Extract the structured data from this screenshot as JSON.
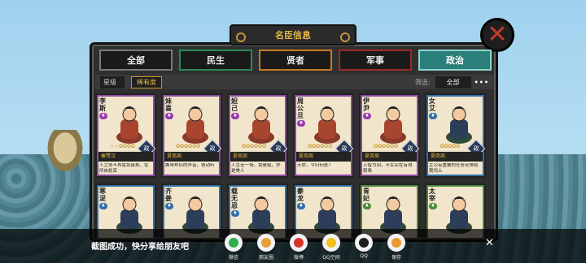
{
  "window": {
    "title": "名臣信息",
    "close_icon": "✕"
  },
  "tabs": [
    {
      "label": "全部",
      "active": false
    },
    {
      "label": "民生",
      "active": false
    },
    {
      "label": "贤者",
      "active": false
    },
    {
      "label": "军事",
      "active": false
    },
    {
      "label": "政治",
      "active": true
    }
  ],
  "filter": {
    "star_label": "星级",
    "rarity_label": "稀有度",
    "filter_label": "筛选:",
    "filter_value": "全部",
    "more": "•••"
  },
  "cards": [
    {
      "name": "李斯",
      "tier": "purple",
      "stars": "☆☆✪✪✪✪",
      "role": "政",
      "dynasty": "秦赞汉",
      "quote": "人之贤不肖譬如鼠矣，在所自处耳"
    },
    {
      "name": "妹喜",
      "tier": "purple",
      "stars": "✪✪✪✪✪✪",
      "role": "政",
      "dynasty": "夏商周",
      "quote": "撕帛布匹的声音，很动听"
    },
    {
      "name": "妲己",
      "tier": "purple",
      "stars": "✪✪✪✪✪✪",
      "role": "政",
      "dynasty": "夏商周",
      "quote": "人生苦一场，我是狐，亦是美人"
    },
    {
      "name": "周公旦",
      "tier": "purple",
      "stars": "✪✪✪✪✪✪",
      "role": "政",
      "dynasty": "夏商周",
      "quote": "天命，今归何处？"
    },
    {
      "name": "伊尹",
      "tier": "purple",
      "stars": "✪✪✪✪✪✪",
      "role": "政",
      "dynasty": "夏商周",
      "quote": "上智为间，不军实在有得箭焉"
    },
    {
      "name": "女艾",
      "tier": "blue",
      "stars": "✪✪✪✪✪",
      "role": "政",
      "dynasty": "夏商周",
      "quote": "主公有重要的任务安排给我吗么"
    },
    {
      "name": "寒浞",
      "tier": "blue",
      "stars": "",
      "role": "",
      "dynasty": "",
      "quote": ""
    },
    {
      "name": "齐姜",
      "tier": "blue",
      "stars": "",
      "role": "",
      "dynasty": "",
      "quote": ""
    },
    {
      "name": "载无忌",
      "tier": "blue",
      "stars": "",
      "role": "",
      "dynasty": "",
      "quote": ""
    },
    {
      "name": "豢龙",
      "tier": "blue",
      "stars": "",
      "role": "",
      "dynasty": "",
      "quote": ""
    },
    {
      "name": "青妃",
      "tier": "green",
      "stars": "",
      "role": "",
      "dynasty": "",
      "quote": ""
    },
    {
      "name": "太宰",
      "tier": "green",
      "stars": "",
      "role": "",
      "dynasty": "",
      "quote": ""
    }
  ],
  "share": {
    "message": "截图成功，快分享给朋友吧",
    "items": [
      {
        "label": "微信",
        "icon": "wechat-icon",
        "color": "#2ab14a"
      },
      {
        "label": "朋友圈",
        "icon": "moments-icon",
        "color": "#e6a03a"
      },
      {
        "label": "微博",
        "icon": "weibo-icon",
        "color": "#d9342b"
      },
      {
        "label": "QQ空间",
        "icon": "qzone-icon",
        "color": "#f2c21a"
      },
      {
        "label": "QQ",
        "icon": "qq-icon",
        "color": "#1d1d1d"
      },
      {
        "label": "保存",
        "icon": "save-icon",
        "color": "#e89a2c"
      }
    ],
    "close": "✕"
  }
}
